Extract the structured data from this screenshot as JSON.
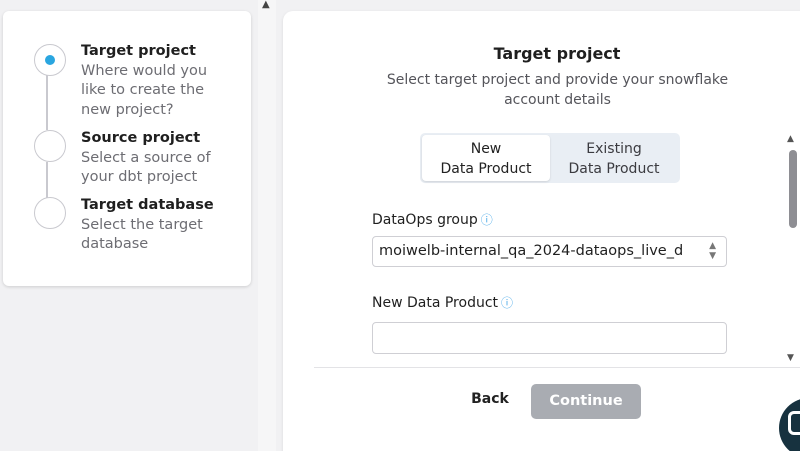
{
  "stepper": {
    "steps": [
      {
        "title": "Target project",
        "description": "Where would you like to create the new project?",
        "state": "active"
      },
      {
        "title": "Source project",
        "description": "Select a source of your dbt project",
        "state": "pending"
      },
      {
        "title": "Target database",
        "description": "Select the target database",
        "state": "pending"
      }
    ]
  },
  "main": {
    "title": "Target project",
    "subtitle": "Select target project and provide your snowflake account details",
    "toggle": {
      "options": [
        {
          "line1": "New",
          "line2": "Data Product",
          "selected": true
        },
        {
          "line1": "Existing",
          "line2": "Data Product",
          "selected": false
        }
      ]
    },
    "dataops_group": {
      "label": "DataOps group",
      "info_icon": "ⓘ",
      "value": "moiwelb-internal_qa_2024-dataops_live_d"
    },
    "new_data_product": {
      "label": "New Data Product",
      "info_icon": "ⓘ",
      "value": ""
    },
    "footer": {
      "back_label": "Back",
      "continue_label": "Continue"
    }
  },
  "colors": {
    "accent": "#2aa6e0",
    "continue_disabled": "#a9acb2",
    "chat_widget": "#17323f"
  }
}
